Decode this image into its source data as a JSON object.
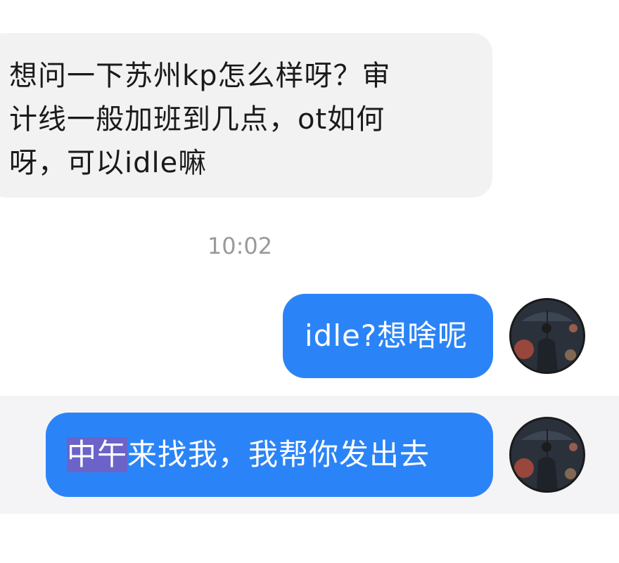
{
  "incoming_message": {
    "lines": [
      "想问一下苏州kp怎么样呀？审",
      "计线一般加班到几点，ot如何",
      "呀，可以idle嘛"
    ]
  },
  "timestamp": "10:02",
  "outgoing_messages": [
    {
      "text": "idle?想啥呢"
    },
    {
      "highlighted_text": "中午",
      "rest_text": "来找我，我帮你发出去"
    }
  ],
  "avatar_icon": "person-with-umbrella-icon",
  "colors": {
    "incoming_bubble": "#f2f2f2",
    "outgoing_bubble": "#2b84f7",
    "selection": "#6c63c9",
    "timestamp": "#9a9a9a"
  }
}
